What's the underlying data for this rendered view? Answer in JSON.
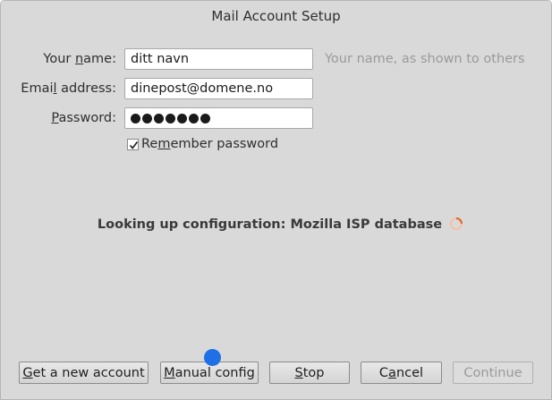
{
  "window": {
    "title": "Mail Account Setup"
  },
  "form": {
    "name_label_pre": "Your ",
    "name_label_key": "n",
    "name_label_post": "ame:",
    "name_value": "ditt navn",
    "name_hint": "Your name, as shown to others",
    "email_label_pre": "Emai",
    "email_label_key": "l",
    "email_label_post": " address:",
    "email_value": "dinepost@domene.no",
    "password_label_key": "P",
    "password_label_post": "assword:",
    "password_dot_count": 7,
    "remember_label_pre": "Re",
    "remember_label_key": "m",
    "remember_label_post": "ember password",
    "remember_checked": true
  },
  "status": {
    "text": "Looking up configuration: Mozilla ISP database",
    "spinner_icon": "loading-spinner-icon"
  },
  "buttons": {
    "get_new_account_key": "G",
    "get_new_account_rest": "et a new account",
    "manual_config_key": "M",
    "manual_config_rest": "anual config",
    "stop_key": "S",
    "stop_rest": "top",
    "cancel_pre": "C",
    "cancel_key": "a",
    "cancel_rest": "ncel",
    "continue_label": "Continue"
  },
  "colors": {
    "background": "#d9d9d9",
    "hint": "#9a9a9a",
    "spinner": "#e8622a",
    "cursor": "#1f6fe6"
  }
}
